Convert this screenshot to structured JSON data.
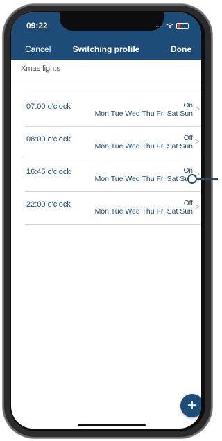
{
  "status": {
    "time": "09:22",
    "signal": "....",
    "colors": {
      "bar": "#1d4c79",
      "battery_low": "#ff3b30"
    }
  },
  "nav": {
    "cancel": "Cancel",
    "title": "Switching profile",
    "done": "Done"
  },
  "profile": {
    "name": "Xmas lights"
  },
  "entries": [
    {
      "time": "07:00 o'clock",
      "state": "On",
      "days": "Mon Tue Wed Thu Fri Sat Sun"
    },
    {
      "time": "08:00 o'clock",
      "state": "Off",
      "days": "Mon Tue Wed Thu Fri Sat Sun"
    },
    {
      "time": "16:45 o'clock",
      "state": "On",
      "days": "Mon Tue Wed Thu Fri Sat Sun"
    },
    {
      "time": "22:00 o'clock",
      "state": "Off",
      "days": "Mon Tue Wed Thu Fri Sat Sun"
    }
  ],
  "icons": {
    "chevron": ">",
    "add": "+"
  },
  "accent_color": "#1d4c79"
}
